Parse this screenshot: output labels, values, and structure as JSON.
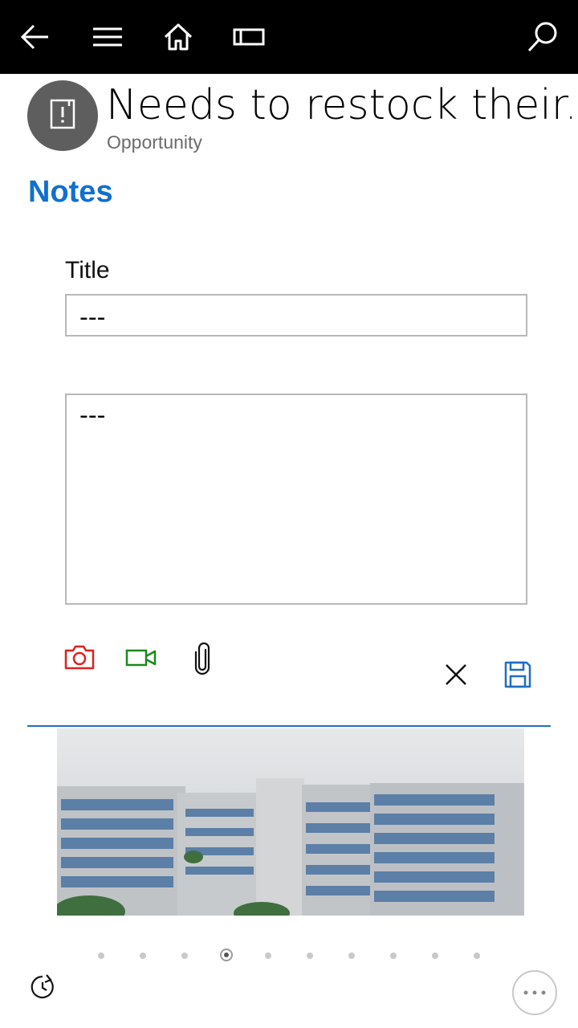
{
  "topbar": {
    "icons": [
      "back-arrow-icon",
      "hamburger-menu-icon",
      "home-icon",
      "dashboard-icon",
      "search-icon"
    ]
  },
  "record": {
    "title": "Needs to restock their...",
    "type": "Opportunity",
    "avatar_icon": "notes-entity-icon"
  },
  "notes": {
    "section_title": "Notes",
    "title_label": "Title",
    "title_value": "---",
    "body_value": "---",
    "attach_icons": [
      "camera-icon",
      "video-camera-icon",
      "paperclip-icon"
    ],
    "cancel_icon": "close-icon",
    "save_icon": "save-icon",
    "colors": {
      "camera": "#e02020",
      "video": "#1a8a1a",
      "save": "#1f6fbf",
      "accent": "#1070d0"
    }
  },
  "gallery": {
    "image": "building-photo",
    "page_count": 10,
    "active_page": 4
  },
  "bottom": {
    "history_icon": "recent-history-icon",
    "more_icon": "more-ellipsis-icon"
  }
}
